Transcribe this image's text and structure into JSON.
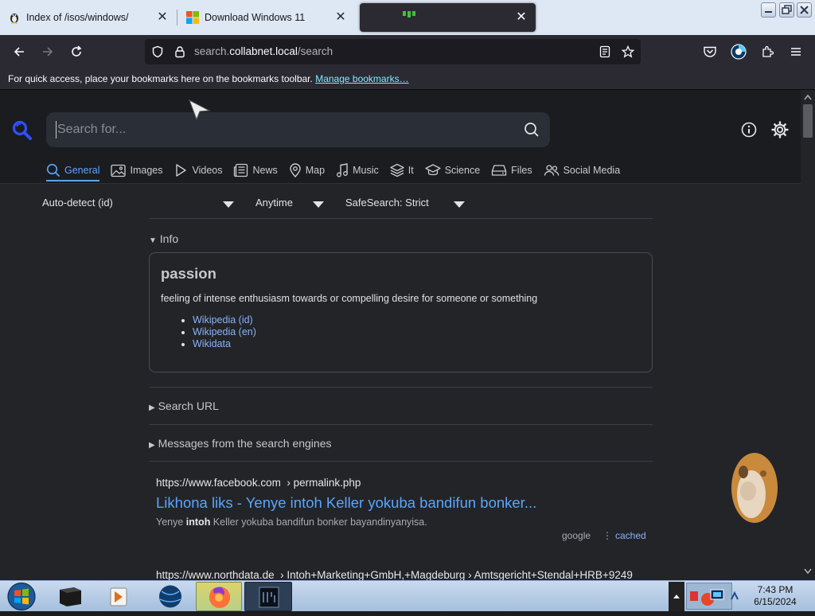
{
  "tabs": [
    {
      "title": "Index of /isos/windows/",
      "icon": "tux-icon"
    },
    {
      "title": "Download Windows 11",
      "icon": "windows-logo-icon"
    },
    {
      "title": "",
      "icon": "search-engine-icon"
    }
  ],
  "nav": {
    "url_prefix": "search.",
    "url_host": "collabnet.local",
    "url_path": "/search"
  },
  "bookmarks_bar": {
    "text": "For quick access, place your bookmarks here on the bookmarks toolbar.",
    "link": "Manage bookmarks…"
  },
  "search": {
    "placeholder": "Search for...",
    "value": ""
  },
  "categories": [
    {
      "label": "General",
      "icon": "search-icon",
      "active": true
    },
    {
      "label": "Images",
      "icon": "image-icon"
    },
    {
      "label": "Videos",
      "icon": "play-icon"
    },
    {
      "label": "News",
      "icon": "newspaper-icon"
    },
    {
      "label": "Map",
      "icon": "map-pin-icon"
    },
    {
      "label": "Music",
      "icon": "music-icon"
    },
    {
      "label": "It",
      "icon": "layers-icon"
    },
    {
      "label": "Science",
      "icon": "graduation-cap-icon"
    },
    {
      "label": "Files",
      "icon": "drive-icon"
    },
    {
      "label": "Social Media",
      "icon": "people-icon"
    }
  ],
  "filters": {
    "language": "Auto-detect (id)",
    "time": "Anytime",
    "safesearch": "SafeSearch: Strict"
  },
  "info": {
    "summary": "Info",
    "word": "passion",
    "definition": "feeling of intense enthusiasm towards or compelling desire for someone or something",
    "links": [
      "Wikipedia (id)",
      "Wikipedia (en)",
      "Wikidata"
    ]
  },
  "sections": {
    "search_url": "Search URL",
    "messages": "Messages from the search engines"
  },
  "results": [
    {
      "url": "https://www.facebook.com",
      "path": "› permalink.php",
      "title": "Likhona liks - Yenye intoh Keller yokuba bandifun bonker...",
      "snippet_pre": "Yenye ",
      "snippet_bold": "intoh",
      "snippet_post": " Keller yokuba bandifun bonker bayandinyanyisa.",
      "engine": "google",
      "cached": "cached"
    },
    {
      "url": "https://www.northdata.de",
      "path": "› Intoh+Marketing+GmbH,+Magdeburg › Amtsgericht+Stendal+HRB+9249"
    }
  ],
  "taskbar": {
    "time": "7:43 PM",
    "date": "6/15/2024"
  },
  "colors": {
    "accent": "#58a6ff",
    "page_bg": "#222428",
    "chrome_bg": "#2b2a33"
  }
}
